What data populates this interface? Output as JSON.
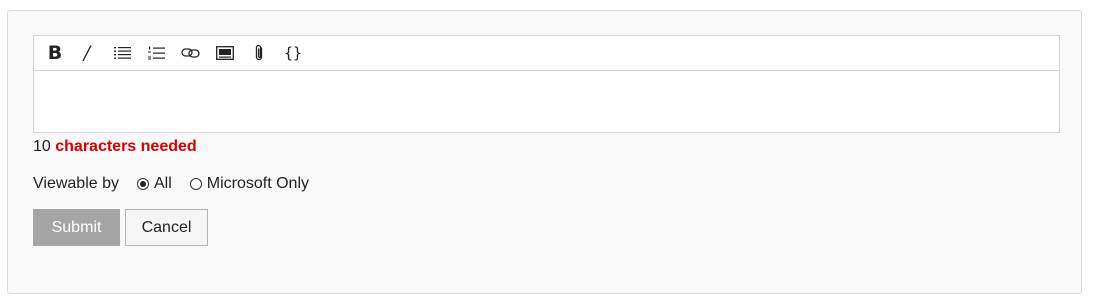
{
  "toolbar": {
    "bold_label": "B",
    "italic_label": "/",
    "code_label": "{}"
  },
  "char_counter": {
    "count": "10",
    "message": "characters needed",
    "message_color": "#d40000"
  },
  "visibility": {
    "label": "Viewable by",
    "options": [
      {
        "label": "All",
        "selected": true
      },
      {
        "label": "Microsoft Only",
        "selected": false
      }
    ]
  },
  "actions": {
    "submit_label": "Submit",
    "cancel_label": "Cancel",
    "submit_color": "#a5a5a5"
  },
  "icons": [
    "bold-icon",
    "italic-icon",
    "bulleted-list-icon",
    "numbered-list-icon",
    "link-icon",
    "image-icon",
    "attachment-icon",
    "code-icon"
  ]
}
